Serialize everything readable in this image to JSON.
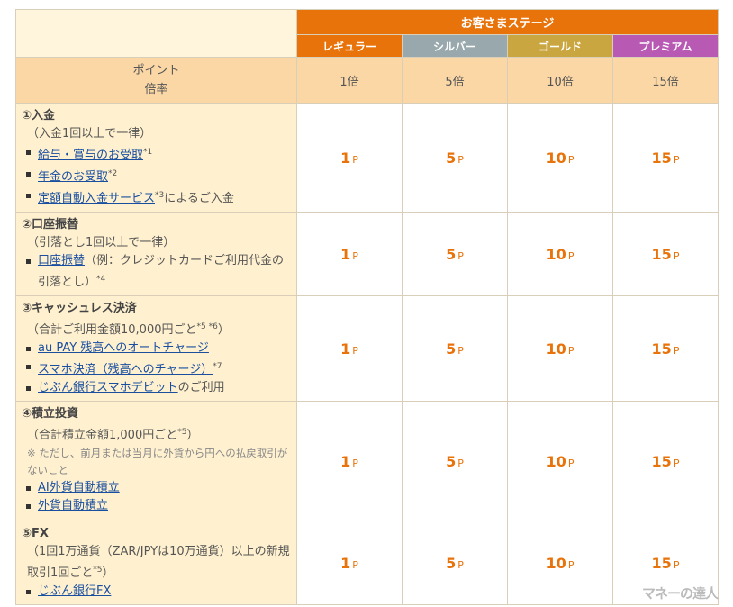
{
  "header": {
    "title": "お客さまステージ",
    "stages": [
      {
        "label": "レギュラー",
        "color": "#e8730b"
      },
      {
        "label": "シルバー",
        "color": "#98a8ac"
      },
      {
        "label": "ゴールド",
        "color": "#c9a640"
      },
      {
        "label": "プレミアム",
        "color": "#b85ab4"
      }
    ]
  },
  "rate_row": {
    "label_line1": "ポイント",
    "label_line2": "倍率",
    "values": [
      "1倍",
      "5倍",
      "10倍",
      "15倍"
    ]
  },
  "categories": [
    {
      "title": "①入金",
      "note": "（入金1回以上で一律）",
      "items": [
        {
          "link": "給与・賞与のお受取",
          "sup": "*1",
          "after": ""
        },
        {
          "link": "年金のお受取",
          "sup": "*2",
          "after": ""
        },
        {
          "link": "定額自動入金サービス",
          "sup": "*3",
          "after": "によるご入金"
        }
      ],
      "points": [
        "1",
        "5",
        "10",
        "15"
      ]
    },
    {
      "title": "②口座振替",
      "note": "（引落とし1回以上で一律）",
      "items": [
        {
          "link": "口座振替",
          "after": "（例：クレジットカードご利用代金の引落とし）",
          "sup": "*4"
        }
      ],
      "points": [
        "1",
        "5",
        "10",
        "15"
      ]
    },
    {
      "title": "③キャッシュレス決済",
      "note_pre": "（合計ご利用金額10,000円ごと",
      "note_sup": "*5 *6",
      "note_post": "）",
      "items": [
        {
          "link": "au PAY 残高へのオートチャージ",
          "sup": "",
          "after": ""
        },
        {
          "link": "スマホ決済（残高へのチャージ）",
          "sup": "*7",
          "after": ""
        },
        {
          "link": "じぶん銀行スマホデビット",
          "sup": "",
          "after": "のご利用"
        }
      ],
      "points": [
        "1",
        "5",
        "10",
        "15"
      ]
    },
    {
      "title": "④積立投資",
      "note_pre": "（合計積立金額1,000円ごと",
      "note_sup": "*5",
      "note_post": "）",
      "warning": "※ ただし、前月または当月に外貨から円への払戻取引がないこと",
      "items": [
        {
          "link": "AI外貨自動積立",
          "sup": "",
          "after": ""
        },
        {
          "link": "外貨自動積立",
          "sup": "",
          "after": ""
        }
      ],
      "points": [
        "1",
        "5",
        "10",
        "15"
      ]
    },
    {
      "title": "⑤FX",
      "note_pre": "（1回1万通貨（ZAR/JPYは10万通貨）以上の新規取引1回ごと",
      "note_sup": "*5",
      "note_post": "）",
      "items": [
        {
          "link": "じぶん銀行FX",
          "sup": "",
          "after": ""
        }
      ],
      "points": [
        "1",
        "5",
        "10",
        "15"
      ]
    }
  ],
  "point_unit": "P",
  "point_color": "#e8730b",
  "watermark": "マネーの達人"
}
